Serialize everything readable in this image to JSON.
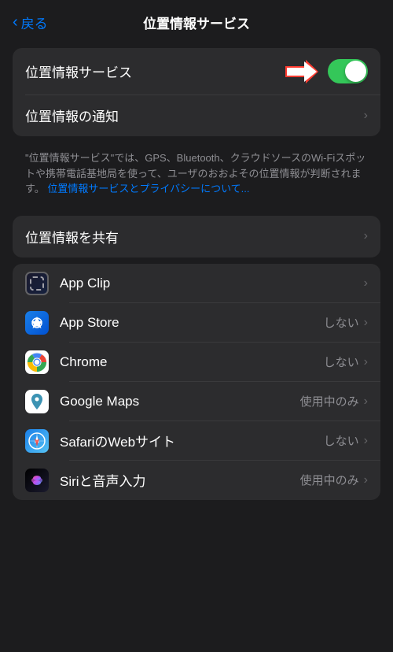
{
  "header": {
    "back_label": "戻る",
    "title": "位置情報サービス"
  },
  "sections": {
    "main": {
      "location_services": {
        "label": "位置情報サービス",
        "toggle_on": true
      },
      "location_notification": {
        "label": "位置情報の通知"
      }
    },
    "description": {
      "text": "\"位置情報サービス\"では、GPS、Bluetooth、クラウドソースのWi-Fiスポットや携帯電話基地局を使って、ユーザのおおよその位置情報が判断されます。",
      "link_text": "位置情報サービスとプライバシーについて..."
    },
    "share": {
      "label": "位置情報を共有"
    },
    "apps": [
      {
        "name": "App Clip",
        "icon_type": "appclip",
        "status": "",
        "has_chevron": true
      },
      {
        "name": "App Store",
        "icon_type": "appstore",
        "status": "しない",
        "has_chevron": true
      },
      {
        "name": "Chrome",
        "icon_type": "chrome",
        "status": "しない",
        "has_chevron": true
      },
      {
        "name": "Google Maps",
        "icon_type": "maps",
        "status": "使用中のみ",
        "has_chevron": true
      },
      {
        "name": "SafariのWebサイト",
        "icon_type": "safari",
        "status": "しない",
        "has_chevron": true
      },
      {
        "name": "Siriと音声入力",
        "icon_type": "siri",
        "status": "使用中のみ",
        "has_chevron": true
      }
    ]
  },
  "colors": {
    "toggle_on": "#34C759",
    "accent": "#007AFF",
    "chevron": "#636366",
    "status_text": "#8e8e93",
    "arrow_red": "#ff3b30"
  }
}
